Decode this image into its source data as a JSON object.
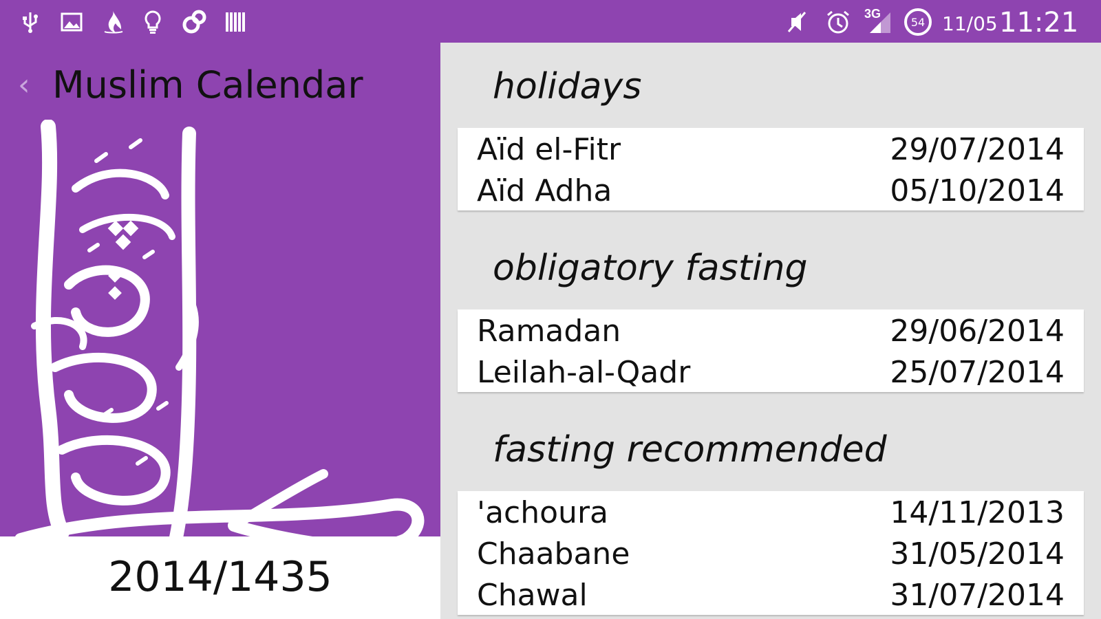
{
  "status_bar": {
    "left_icons": [
      "usb-icon",
      "image-icon",
      "flame-app-icon",
      "lightbulb-icon",
      "sync-icon",
      "barcode-icon"
    ],
    "right_icons": [
      "mute-icon",
      "alarm-icon",
      "signal-icon",
      "battery-icon"
    ],
    "network": "3G",
    "battery_level": "54",
    "date": "11/05",
    "time": "11:21"
  },
  "header": {
    "back_icon": "chevron-left-icon",
    "title": "Muslim Calendar"
  },
  "year": "2014/1435",
  "colors": {
    "accent": "#8e44b0",
    "background_right": "#e3e3e3",
    "card": "#ffffff",
    "text": "#111111"
  },
  "sections": [
    {
      "title": "holidays",
      "items": [
        {
          "name": "Aïd el-Fitr",
          "date": "29/07/2014"
        },
        {
          "name": "Aïd Adha",
          "date": "05/10/2014"
        }
      ]
    },
    {
      "title": "obligatory fasting",
      "items": [
        {
          "name": "Ramadan",
          "date": "29/06/2014"
        },
        {
          "name": "Leilah-al-Qadr",
          "date": "25/07/2014"
        }
      ]
    },
    {
      "title": "fasting recommended",
      "items": [
        {
          "name": "'achoura",
          "date": "14/11/2013"
        },
        {
          "name": "Chaabane",
          "date": "31/05/2014"
        },
        {
          "name": "Chawal",
          "date": "31/07/2014"
        }
      ]
    }
  ]
}
